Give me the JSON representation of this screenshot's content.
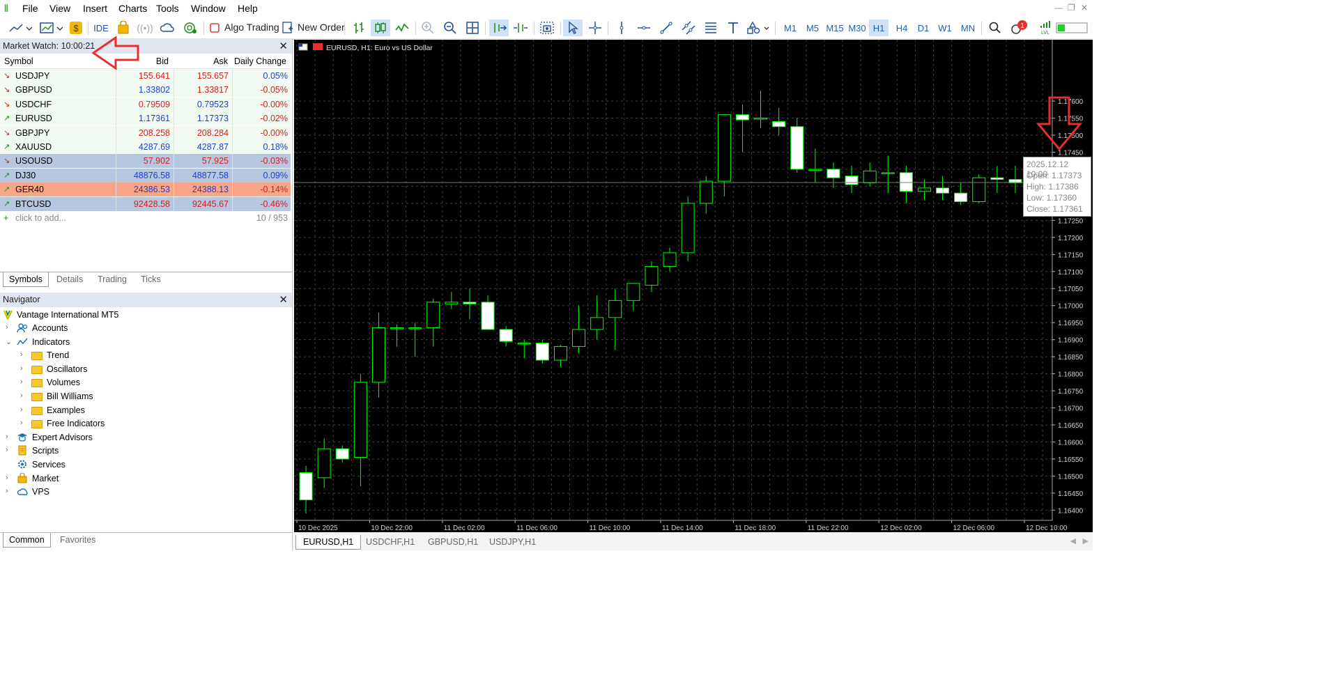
{
  "menu": [
    "File",
    "View",
    "Insert",
    "Charts",
    "Tools",
    "Window",
    "Help"
  ],
  "toolbar": {
    "ide_label": "IDE",
    "algo_label": "Algo Trading",
    "new_order_label": "New Order",
    "timeframes": [
      "M1",
      "M5",
      "M15",
      "M30",
      "H1",
      "H4",
      "D1",
      "W1",
      "MN"
    ],
    "selected_timeframe": "H1",
    "notification_count": "1"
  },
  "market_watch": {
    "title": "Market Watch: 10:00:21",
    "columns": [
      "Symbol",
      "Bid",
      "Ask",
      "Daily Change"
    ],
    "rows": [
      {
        "symbol": "USDJPY",
        "bid": "155.641",
        "ask": "155.657",
        "change": "0.05%",
        "dir": "down",
        "bidColor": "#d42020",
        "askColor": "#d42020",
        "chgColor": "#1f3fd0",
        "bg": "#f2fbf2"
      },
      {
        "symbol": "GBPUSD",
        "bid": "1.33802",
        "ask": "1.33817",
        "change": "-0.05%",
        "dir": "down",
        "bidColor": "#1f3fd0",
        "askColor": "#d42020",
        "chgColor": "#d42020",
        "bg": "#f2fbf2"
      },
      {
        "symbol": "USDCHF",
        "bid": "0.79509",
        "ask": "0.79523",
        "change": "-0.00%",
        "dir": "down",
        "bidColor": "#d42020",
        "askColor": "#1f3fd0",
        "chgColor": "#d42020",
        "bg": "#f2fbf2"
      },
      {
        "symbol": "EURUSD",
        "bid": "1.17361",
        "ask": "1.17373",
        "change": "-0.02%",
        "dir": "up",
        "bidColor": "#1f3fd0",
        "askColor": "#1f3fd0",
        "chgColor": "#d42020",
        "bg": "#f2fbf2"
      },
      {
        "symbol": "GBPJPY",
        "bid": "208.258",
        "ask": "208.284",
        "change": "-0.00%",
        "dir": "down",
        "bidColor": "#d42020",
        "askColor": "#d42020",
        "chgColor": "#d42020",
        "bg": "#f2fbf2"
      },
      {
        "symbol": "XAUUSD",
        "bid": "4287.69",
        "ask": "4287.87",
        "change": "0.18%",
        "dir": "up",
        "bidColor": "#1f3fd0",
        "askColor": "#1f3fd0",
        "chgColor": "#1f3fd0",
        "bg": "#f2fbf2"
      },
      {
        "symbol": "USOUSD",
        "bid": "57.902",
        "ask": "57.925",
        "change": "-0.03%",
        "dir": "down",
        "bidColor": "#d42020",
        "askColor": "#d42020",
        "chgColor": "#d42020",
        "bg": "#b5c6de"
      },
      {
        "symbol": "DJ30",
        "bid": "48876.58",
        "ask": "48877.58",
        "change": "0.09%",
        "dir": "up",
        "bidColor": "#1f3fd0",
        "askColor": "#1f3fd0",
        "chgColor": "#1f3fd0",
        "bg": "#b5c6de"
      },
      {
        "symbol": "GER40",
        "bid": "24386.53",
        "ask": "24388.13",
        "change": "-0.14%",
        "dir": "up",
        "bidColor": "#1f3fd0",
        "askColor": "#1f3fd0",
        "chgColor": "#d42020",
        "bg": "#f8a687"
      },
      {
        "symbol": "BTCUSD",
        "bid": "92428.58",
        "ask": "92445.67",
        "change": "-0.46%",
        "dir": "up",
        "bidColor": "#d42020",
        "askColor": "#d42020",
        "chgColor": "#d42020",
        "bg": "#b5c6de"
      }
    ],
    "add_label": "click to add...",
    "count": "10 / 953",
    "tabs": [
      "Symbols",
      "Details",
      "Trading",
      "Ticks"
    ],
    "active_tab": "Symbols"
  },
  "navigator": {
    "title": "Navigator",
    "root": "Vantage International MT5",
    "items": [
      {
        "label": "Accounts",
        "level": 1,
        "exp": "›",
        "icon": "accounts-icon"
      },
      {
        "label": "Indicators",
        "level": 1,
        "exp": "⌄",
        "icon": "indicators-icon"
      },
      {
        "label": "Trend",
        "level": 2,
        "exp": "›",
        "icon": "folder-icon"
      },
      {
        "label": "Oscillators",
        "level": 2,
        "exp": "›",
        "icon": "folder-icon"
      },
      {
        "label": "Volumes",
        "level": 2,
        "exp": "›",
        "icon": "folder-icon"
      },
      {
        "label": "Bill Williams",
        "level": 2,
        "exp": "›",
        "icon": "folder-icon"
      },
      {
        "label": "Examples",
        "level": 2,
        "exp": "›",
        "icon": "folder-icon"
      },
      {
        "label": "Free Indicators",
        "level": 2,
        "exp": "›",
        "icon": "folder-icon"
      },
      {
        "label": "Expert Advisors",
        "level": 1,
        "exp": "›",
        "icon": "expert-icon"
      },
      {
        "label": "Scripts",
        "level": 1,
        "exp": "›",
        "icon": "scripts-icon"
      },
      {
        "label": "Services",
        "level": 1,
        "exp": "",
        "icon": "services-icon"
      },
      {
        "label": "Market",
        "level": 1,
        "exp": "›",
        "icon": "market-icon"
      },
      {
        "label": "VPS",
        "level": 1,
        "exp": "›",
        "icon": "vps-icon"
      }
    ],
    "tabs": [
      "Common",
      "Favorites"
    ],
    "active_tab": "Common"
  },
  "chart": {
    "title": "EURUSD, H1:  Euro vs US Dollar",
    "current_price": "1.17361",
    "tooltip": {
      "time": "2025.12.12 10:00",
      "open": "Open: 1.17373",
      "high": "High: 1.17386",
      "low": "Low: 1.17360",
      "close": "Close: 1.17361"
    },
    "tabs": [
      "EURUSD,H1",
      "USDCHF,H1",
      "GBPUSD,H1",
      "USDJPY,H1"
    ],
    "active_tab": "EURUSD,H1"
  },
  "chart_data": {
    "type": "candlestick",
    "symbol": "EURUSD",
    "timeframe": "H1",
    "ylim": [
      1.1637,
      1.1778
    ],
    "y_ticks": [
      "1.17600",
      "1.17550",
      "1.17500",
      "1.17450",
      "1.17400",
      "1.17350",
      "1.17300",
      "1.17250",
      "1.17200",
      "1.17150",
      "1.17100",
      "1.17050",
      "1.17000",
      "1.16950",
      "1.16900",
      "1.16850",
      "1.16800",
      "1.16750",
      "1.16700",
      "1.16650",
      "1.16600",
      "1.16550",
      "1.16500",
      "1.16450",
      "1.16400"
    ],
    "x_ticks": [
      "10 Dec 2025",
      "10 Dec 22:00",
      "11 Dec 02:00",
      "11 Dec 06:00",
      "11 Dec 10:00",
      "11 Dec 14:00",
      "11 Dec 18:00",
      "11 Dec 22:00",
      "12 Dec 02:00",
      "12 Dec 06:00",
      "12 Dec 10:00"
    ],
    "candles": [
      [
        1.1651,
        1.1653,
        1.1639,
        1.1643
      ],
      [
        1.16495,
        1.1661,
        1.16465,
        1.1658
      ],
      [
        1.1658,
        1.1659,
        1.1654,
        1.1655
      ],
      [
        1.16555,
        1.168,
        1.1647,
        1.16775
      ],
      [
        1.16775,
        1.1698,
        1.1673,
        1.16935
      ],
      [
        1.16935,
        1.16945,
        1.1688,
        1.16935
      ],
      [
        1.16935,
        1.1695,
        1.1685,
        1.16935
      ],
      [
        1.16935,
        1.1702,
        1.1688,
        1.1701
      ],
      [
        1.17005,
        1.1704,
        1.1699,
        1.1701
      ],
      [
        1.1701,
        1.1705,
        1.1696,
        1.17005
      ],
      [
        1.1701,
        1.1703,
        1.1693,
        1.1693
      ],
      [
        1.1693,
        1.1694,
        1.1688,
        1.16895
      ],
      [
        1.1689,
        1.169,
        1.16845,
        1.1689
      ],
      [
        1.1689,
        1.169,
        1.1683,
        1.1684
      ],
      [
        1.1684,
        1.16885,
        1.1682,
        1.1688
      ],
      [
        1.1688,
        1.17,
        1.1686,
        1.1693
      ],
      [
        1.1693,
        1.1703,
        1.169,
        1.16965
      ],
      [
        1.16965,
        1.1705,
        1.1687,
        1.17015
      ],
      [
        1.17015,
        1.1706,
        1.16985,
        1.17065
      ],
      [
        1.1706,
        1.1713,
        1.1704,
        1.17115
      ],
      [
        1.17115,
        1.1717,
        1.171,
        1.17155
      ],
      [
        1.17155,
        1.1732,
        1.1713,
        1.173
      ],
      [
        1.173,
        1.1738,
        1.1727,
        1.17365
      ],
      [
        1.17365,
        1.1756,
        1.1732,
        1.1756
      ],
      [
        1.1756,
        1.1759,
        1.1745,
        1.17545
      ],
      [
        1.1755,
        1.1763,
        1.1752,
        1.1755
      ],
      [
        1.1754,
        1.1758,
        1.175,
        1.17525
      ],
      [
        1.17525,
        1.1755,
        1.1739,
        1.174
      ],
      [
        1.174,
        1.1746,
        1.1736,
        1.174
      ],
      [
        1.174,
        1.1742,
        1.17345,
        1.17375
      ],
      [
        1.1738,
        1.1741,
        1.1733,
        1.17355
      ],
      [
        1.1736,
        1.1742,
        1.1735,
        1.17395
      ],
      [
        1.1739,
        1.1744,
        1.1733,
        1.1739
      ],
      [
        1.1739,
        1.1741,
        1.173,
        1.17335
      ],
      [
        1.17335,
        1.1737,
        1.1731,
        1.17345
      ],
      [
        1.17345,
        1.1738,
        1.1731,
        1.1733
      ],
      [
        1.1733,
        1.1736,
        1.17295,
        1.17305
      ],
      [
        1.17305,
        1.17385,
        1.173,
        1.17375
      ],
      [
        1.17375,
        1.1741,
        1.1733,
        1.1737
      ],
      [
        1.1737,
        1.1741,
        1.1733,
        1.1736
      ],
      [
        1.17373,
        1.17386,
        1.1736,
        1.17361
      ]
    ]
  },
  "colors": {
    "bull": "#00ff00",
    "bear_body": "#ffffff",
    "grid": "#3a3a3a",
    "accent": "#1f5fb0",
    "annotation": "#e53030"
  }
}
